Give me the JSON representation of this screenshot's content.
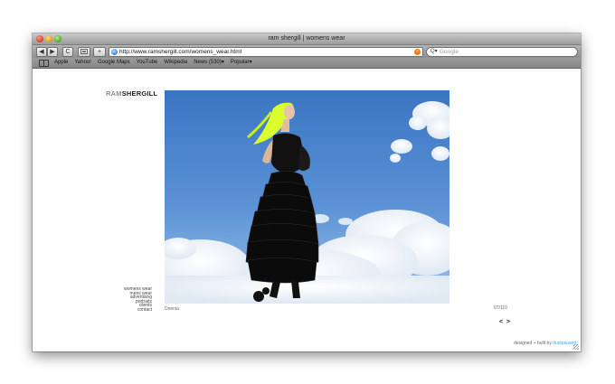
{
  "window": {
    "title": "ram shergill | womens wear"
  },
  "toolbar": {
    "back_label": "◀",
    "forward_label": "▶",
    "reload_label": "C",
    "add_label": "+",
    "url": "http://www.ramshergill.com/womens_wear.html",
    "search_placeholder": "Google"
  },
  "bookmarks": {
    "items": [
      "Apple",
      "Yahoo!",
      "Google Maps",
      "YouTube",
      "Wikipedia",
      "News (530)▾",
      "Popular▾"
    ]
  },
  "site": {
    "logo_light": "RAM",
    "logo_dark": "SHERGILL",
    "nav": [
      "womens wear",
      "mens wear",
      "advertising",
      "portraits",
      "clients",
      "contact"
    ],
    "caption": "Dnenia",
    "counter": "07/110",
    "pager": "< >",
    "footer_prefix": "designed + built by",
    "footer_brand": "dustpaused"
  },
  "colors": {
    "sky_top": "#3f7cc6",
    "sky_bottom": "#8fb9e4",
    "accent": "#47a7d8",
    "hair": "#d9ff2e"
  }
}
